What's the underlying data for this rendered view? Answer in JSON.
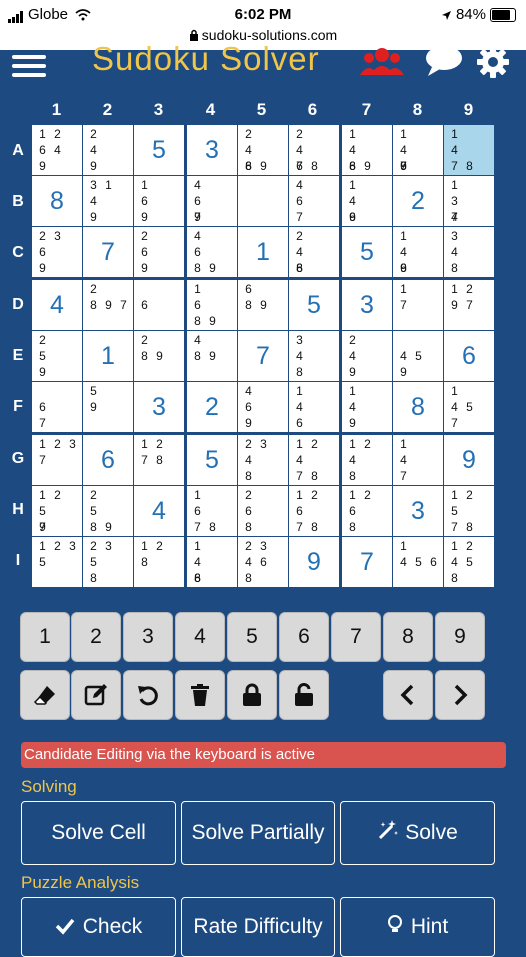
{
  "status": {
    "carrier": "Globe",
    "time": "6:02 PM",
    "url": "sudoku-solutions.com",
    "battery": "84%",
    "battery_level": 0.84
  },
  "header": {
    "title": "Sudoku Solver"
  },
  "columns": [
    "1",
    "2",
    "3",
    "4",
    "5",
    "6",
    "7",
    "8",
    "9"
  ],
  "rows": [
    "A",
    "B",
    "C",
    "D",
    "E",
    "F",
    "G",
    "H",
    "I"
  ],
  "board": [
    [
      {
        "c": "12 64 9"
      },
      {
        "c": "2 4 9"
      },
      {
        "v": "5"
      },
      {
        "v": "3"
      },
      {
        "c": "2 4 6 89"
      },
      {
        "c": "2 4 6 78"
      },
      {
        "c": "1 4 6 89"
      },
      {
        "c": "1 4 6 7 9"
      },
      {
        "c": "1 4 78",
        "sel": true
      }
    ],
    [
      {
        "v": "8"
      },
      {
        "c": "31 4 9"
      },
      {
        "c": "1 6 9"
      },
      {
        "c": "4 6 7 9"
      },
      {
        "c": ""
      },
      {
        "c": "4 6 7"
      },
      {
        "c": "1 4 6 9"
      },
      {
        "v": "2"
      },
      {
        "c": "1 3 4 7"
      }
    ],
    [
      {
        "c": "23 6 9"
      },
      {
        "v": "7"
      },
      {
        "c": "2 6 9"
      },
      {
        "c": "4 6 89"
      },
      {
        "v": "1"
      },
      {
        "c": "2 4 6 8"
      },
      {
        "v": "5"
      },
      {
        "c": "1 4 6 9"
      },
      {
        "c": "3 4 8"
      }
    ],
    [
      {
        "v": "4"
      },
      {
        "c": "2 897"
      },
      {
        "c": " 6"
      },
      {
        "c": "1 6 89"
      },
      {
        "c": "6 89"
      },
      {
        "v": "5"
      },
      {
        "v": "3"
      },
      {
        "c": "1 7"
      },
      {
        "c": "12 97"
      }
    ],
    [
      {
        "c": "2 5 9"
      },
      {
        "v": "1"
      },
      {
        "c": "2 89"
      },
      {
        "c": "4 89"
      },
      {
        "v": "7"
      },
      {
        "c": "3 4 8"
      },
      {
        "c": "2 4 9"
      },
      {
        "c": " 45 9"
      },
      {
        "v": "6"
      }
    ],
    [
      {
        "c": " 6 7"
      },
      {
        "c": "5 9"
      },
      {
        "v": "3"
      },
      {
        "v": "2"
      },
      {
        "c": "4 6 9"
      },
      {
        "c": "1 4 6"
      },
      {
        "c": "1 4 9"
      },
      {
        "v": "8"
      },
      {
        "c": "1 45 7"
      }
    ],
    [
      {
        "c": "123 7"
      },
      {
        "v": "6"
      },
      {
        "c": "12 78"
      },
      {
        "v": "5"
      },
      {
        "c": "23 4 8"
      },
      {
        "c": "12 4 78"
      },
      {
        "c": "12 4 8"
      },
      {
        "c": "1 4 7"
      },
      {
        "v": "9"
      }
    ],
    [
      {
        "c": "12 5 7 9"
      },
      {
        "c": "2 5 89"
      },
      {
        "v": "4"
      },
      {
        "c": "1 6 78"
      },
      {
        "c": "2 6 8"
      },
      {
        "c": "12 6 78"
      },
      {
        "c": "12 6 8"
      },
      {
        "v": "3"
      },
      {
        "c": "12 5 78"
      }
    ],
    [
      {
        "c": "123 5"
      },
      {
        "c": "23 5 8"
      },
      {
        "c": "12 8"
      },
      {
        "c": "1 4 6 8"
      },
      {
        "c": "23 46 8"
      },
      {
        "v": "9"
      },
      {
        "v": "7"
      },
      {
        "c": "1 456"
      },
      {
        "c": "12 45 8"
      }
    ]
  ],
  "numpad": [
    "1",
    "2",
    "3",
    "4",
    "5",
    "6",
    "7",
    "8",
    "9"
  ],
  "tools": [
    "eraser-icon",
    "edit-icon",
    "undo-icon",
    "trash-icon",
    "lock-icon",
    "unlock-icon",
    "chevron-left-icon",
    "chevron-right-icon"
  ],
  "alert": "Candidate Editing via the keyboard is active",
  "solving": {
    "label": "Solving",
    "solve_cell": "Solve Cell",
    "solve_partially": "Solve Partially",
    "solve": "Solve"
  },
  "analysis": {
    "label": "Puzzle Analysis",
    "check": "Check",
    "rate": "Rate Difficulty",
    "hint": "Hint"
  },
  "colors": {
    "background": "#1d4a80",
    "accent": "#f0c54a",
    "digit": "#2470b5",
    "alert": "#d9534f",
    "selected": "#a9d6eb"
  }
}
